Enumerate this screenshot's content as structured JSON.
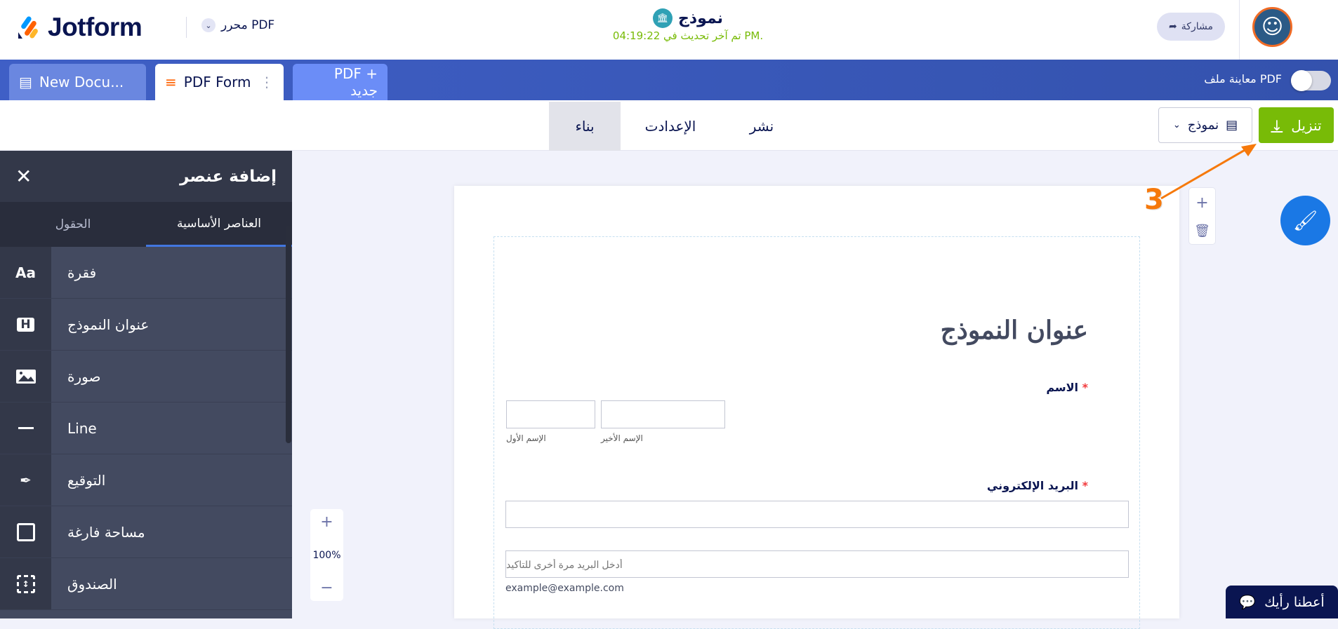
{
  "header": {
    "logo_text": "Jotform",
    "product": "PDF محرر",
    "form_title": "نموذج",
    "last_updated": ".PM تم آخر تحديث في 04:19:22",
    "share_label": "مشاركة"
  },
  "doc_tabs": [
    {
      "label": "New Docu..."
    },
    {
      "label": "PDF Form"
    },
    {
      "label": "+ PDF جديد"
    }
  ],
  "preview_toggle": {
    "label": "PDF معاينة ملف",
    "on": false
  },
  "sub_tabs": {
    "build": "بناء",
    "settings": "الإعدادت",
    "publish": "نشر",
    "active": "build"
  },
  "form_select": {
    "label": "نموذج"
  },
  "download": {
    "label": "تنزيل"
  },
  "sidebar": {
    "title": "إضافة عنصر",
    "tabs": [
      "العناصر الأساسية",
      "الحقول"
    ],
    "active_tab": 0,
    "items": [
      {
        "icon": "Aa",
        "label": "فقرة"
      },
      {
        "icon": "H",
        "label": "عنوان النموذج"
      },
      {
        "icon": "image",
        "label": "صورة"
      },
      {
        "icon": "line",
        "label": "Line"
      },
      {
        "icon": "signature",
        "label": "التوقيع"
      },
      {
        "icon": "square",
        "label": "مساحة فارغة"
      },
      {
        "icon": "box",
        "label": "الصندوق"
      }
    ]
  },
  "zoom": {
    "plus": "+",
    "level": "100%",
    "minus": "−"
  },
  "form": {
    "heading": "عنوان النموذج",
    "name_label": "الاسم",
    "first_name": "الإسم الأول",
    "last_name": "الإسم الأخير",
    "email_label": "البريد الإلكتروني",
    "confirm_placeholder": "أدخل البريد مرة أخرى للتاكيد",
    "email_hint": "example@example.com",
    "required_mark": "*"
  },
  "annotation": {
    "step": "3",
    "color": "#f6790b"
  },
  "feedback": {
    "label": "أعطنا رأيك"
  },
  "colors": {
    "brand_blue": "#3f5fc6",
    "green": "#78bb07",
    "navy": "#0a1551",
    "sidebar": "#434a60"
  }
}
